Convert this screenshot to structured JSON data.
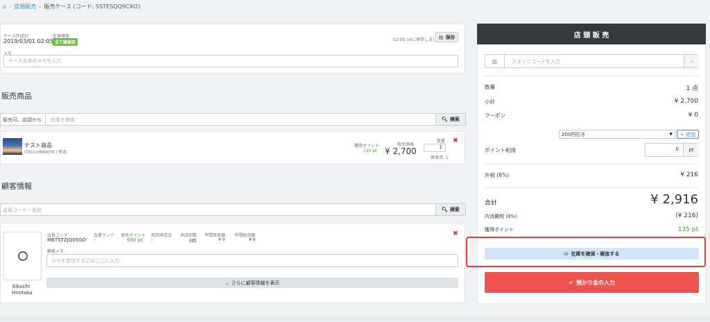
{
  "breadcrumb": {
    "home_icon": "home-icon",
    "link": "店頭販売",
    "current": "販売ケース (コード: SSTESQQ9CXI2)"
  },
  "case": {
    "created_label": "ケース作成日",
    "created_value": "2019/03/01 02:05",
    "stock_label": "在庫確保",
    "stock_badge": "全て確保済",
    "saved_text": "02:05:14に保存しました",
    "save_button": "保存",
    "memo_label": "メモ",
    "memo_placeholder": "ケース全体のメモを入力"
  },
  "products": {
    "title": "販売商品",
    "filter_label": "販売可、店頭から",
    "search_placeholder": "在庫を検索",
    "search_button": "検索",
    "item": {
      "name": "テスト商品",
      "code": "IT6D1HB6WYK / 新品",
      "points_label": "獲得ポイント",
      "points_value": "135 pt",
      "price_label": "販売価格",
      "price_value": "¥ 2,700",
      "qty_label": "数量",
      "qty_value": "1",
      "reserved": "確保済: 1"
    }
  },
  "customer": {
    "title": "顧客情報",
    "search_placeholder": "会員コード・名前",
    "search_button": "検索",
    "stats": [
      {
        "label": "会員コード",
        "value": "MBTSTZJQ05GO"
      },
      {
        "label": "会員ランク",
        "value": "-"
      },
      {
        "label": "保有ポイント",
        "value": "690 pt"
      },
      {
        "label": "前回来店日",
        "value": "-"
      },
      {
        "label": "来店回数",
        "value": "0回"
      },
      {
        "label": "年間買取額",
        "value": "¥ 0"
      },
      {
        "label": "年間販売額",
        "value": "¥ 0"
      }
    ],
    "memo_label": "顧客メモ",
    "memo_placeholder": "メモを追加するにはここに入力",
    "more_button": "さらに顧客情報を表示",
    "name_line1": "Kikuchi",
    "name_line2": "Hirotaka"
  },
  "register": {
    "title": "店 頭 販 売",
    "staff_placeholder": "スタッフコードを入力",
    "staff_minus": "-",
    "qty_label": "数量",
    "qty_value": "1 点",
    "subtotal_label": "小計",
    "subtotal_value": "¥ 2,700",
    "coupon_label": "クーポン",
    "coupon_value": "¥ 0",
    "coupon_select": "200円引き",
    "add_button": "+ 追加",
    "points_use_label": "ポイント利用",
    "points_use_value": "0",
    "points_unit": "pt",
    "tax_ext_label": "外税 (8%)",
    "tax_ext_value": "¥ 216",
    "total_label": "合計",
    "total_value": "¥ 2,916",
    "tax_in_label": "内消費税 (8%)",
    "tax_in_value": "(¥ 216)",
    "earn_label": "獲得ポイント",
    "earn_value": "135 pt",
    "reserve_button": "在庫を確保・解放する",
    "deposit_button": "預かり金の入力"
  },
  "colors": {
    "accent": "#3a8fd6",
    "dark_header": "#34393e",
    "danger": "#ef5350",
    "success": "#4a9b3a",
    "highlight": "#e53935",
    "reserve_bg": "#cfe6f7"
  }
}
